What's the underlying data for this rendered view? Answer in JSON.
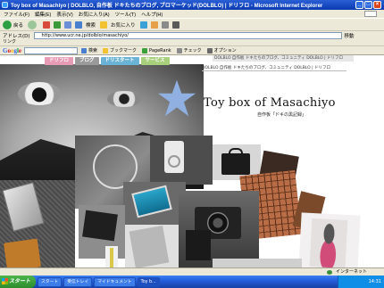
{
  "window": {
    "title": "Toy box of Masachiyo | DOLBLO, 自作板 ドキたちのブログ, ブロマーケッド(DOLBLO) | ドリフロ - Microsoft Internet Explorer"
  },
  "menubar": {
    "items": [
      "ファイル(F)",
      "編集(E)",
      "表示(V)",
      "お気に入り(A)",
      "ツール(T)",
      "ヘルプ(H)"
    ]
  },
  "toolbar": {
    "back_label": "戻る",
    "search_label": "検索",
    "favorites_label": "お気に入り"
  },
  "addressbar": {
    "label": "アドレス(D)",
    "url": "http://www.ucr.ne.jp/dolblo/masachiyo/",
    "go_label": "移動",
    "links_label": "リンク"
  },
  "googlebar": {
    "logo": "Google",
    "items": [
      "検索",
      "ブックマーク",
      "PageRank",
      "チェック",
      "オプション"
    ]
  },
  "page": {
    "site_notice": "DOLBLO 自作板 ドキたちのブログ、コミュニティ DOLBLO | ドリフロ",
    "nav_tabs": [
      "ドリフロ",
      "ブログ",
      "ドリスタート",
      "サービス"
    ],
    "subbar_text": "DOLBLO 自作板 ドキたちのブログ、コミュニティ DOLBLO | ドリフロ",
    "title": "Toy box of Masachiyo",
    "subtitle": "自作板「ドキの黒記録」"
  },
  "statusbar": {
    "text": "",
    "zone": "インターネット"
  },
  "taskbar": {
    "start_label": "スタート",
    "buttons": [
      "スタート",
      "受信トレイ",
      "マイドキュメント",
      "Toy b..."
    ],
    "time": "14:31"
  },
  "colors": {
    "titlebar": "#0a3ab0",
    "star": "#8fb0e0",
    "tab_pink": "#e89bb5",
    "tab_gray": "#9a9a9a",
    "tab_blue": "#6ab3d6",
    "tab_green": "#a7cf7c"
  }
}
